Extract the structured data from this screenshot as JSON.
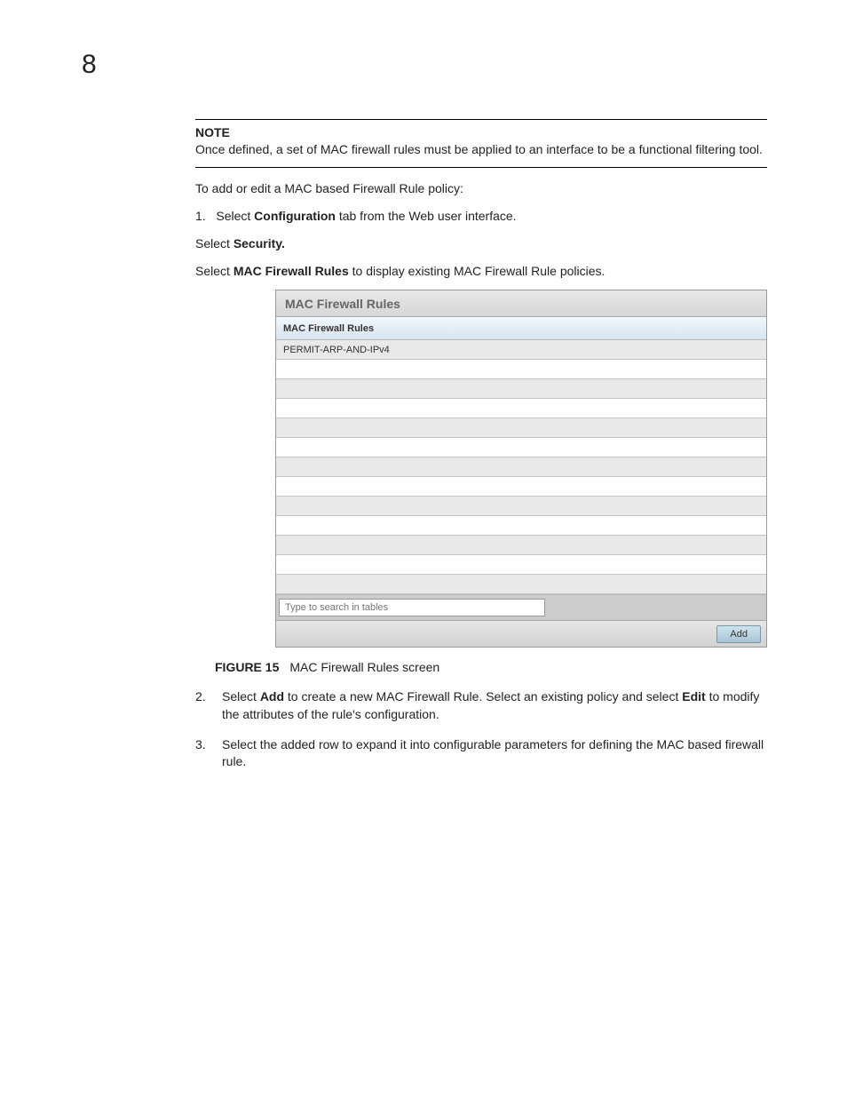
{
  "page_number": "8",
  "note": {
    "heading": "NOTE",
    "body": "Once defined, a set of MAC firewall rules must be applied to an interface to be a functional filtering tool."
  },
  "intro_line": "To add or edit a MAC based Firewall Rule policy:",
  "step1": {
    "num": "1.",
    "prefix": "Select ",
    "bold": "Configuration",
    "suffix": " tab from the Web user interface."
  },
  "select_security": {
    "prefix": "Select ",
    "bold": "Security."
  },
  "select_rules": {
    "prefix": "Select ",
    "bold": "MAC Firewall Rules",
    "suffix": " to display existing MAC Firewall Rule policies."
  },
  "screenshot": {
    "panel_title": "MAC Firewall Rules",
    "column_header": "MAC Firewall Rules",
    "rows": [
      "PERMIT-ARP-AND-IPv4",
      "",
      "",
      "",
      "",
      "",
      "",
      "",
      "",
      "",
      "",
      "",
      "",
      ""
    ],
    "search_placeholder": "Type to search in tables",
    "add_button": "Add"
  },
  "figure": {
    "label": "FIGURE 15",
    "caption": "MAC Firewall Rules screen"
  },
  "step2": {
    "num": "2.",
    "p1": "Select ",
    "b1": "Add",
    "p2": " to create a new MAC Firewall Rule. Select an existing policy and select ",
    "b2": "Edit",
    "p3": " to modify the attributes of the rule's configuration."
  },
  "step3": {
    "num": "3.",
    "body": "Select the added row to expand it into configurable parameters for defining the MAC based firewall rule."
  }
}
